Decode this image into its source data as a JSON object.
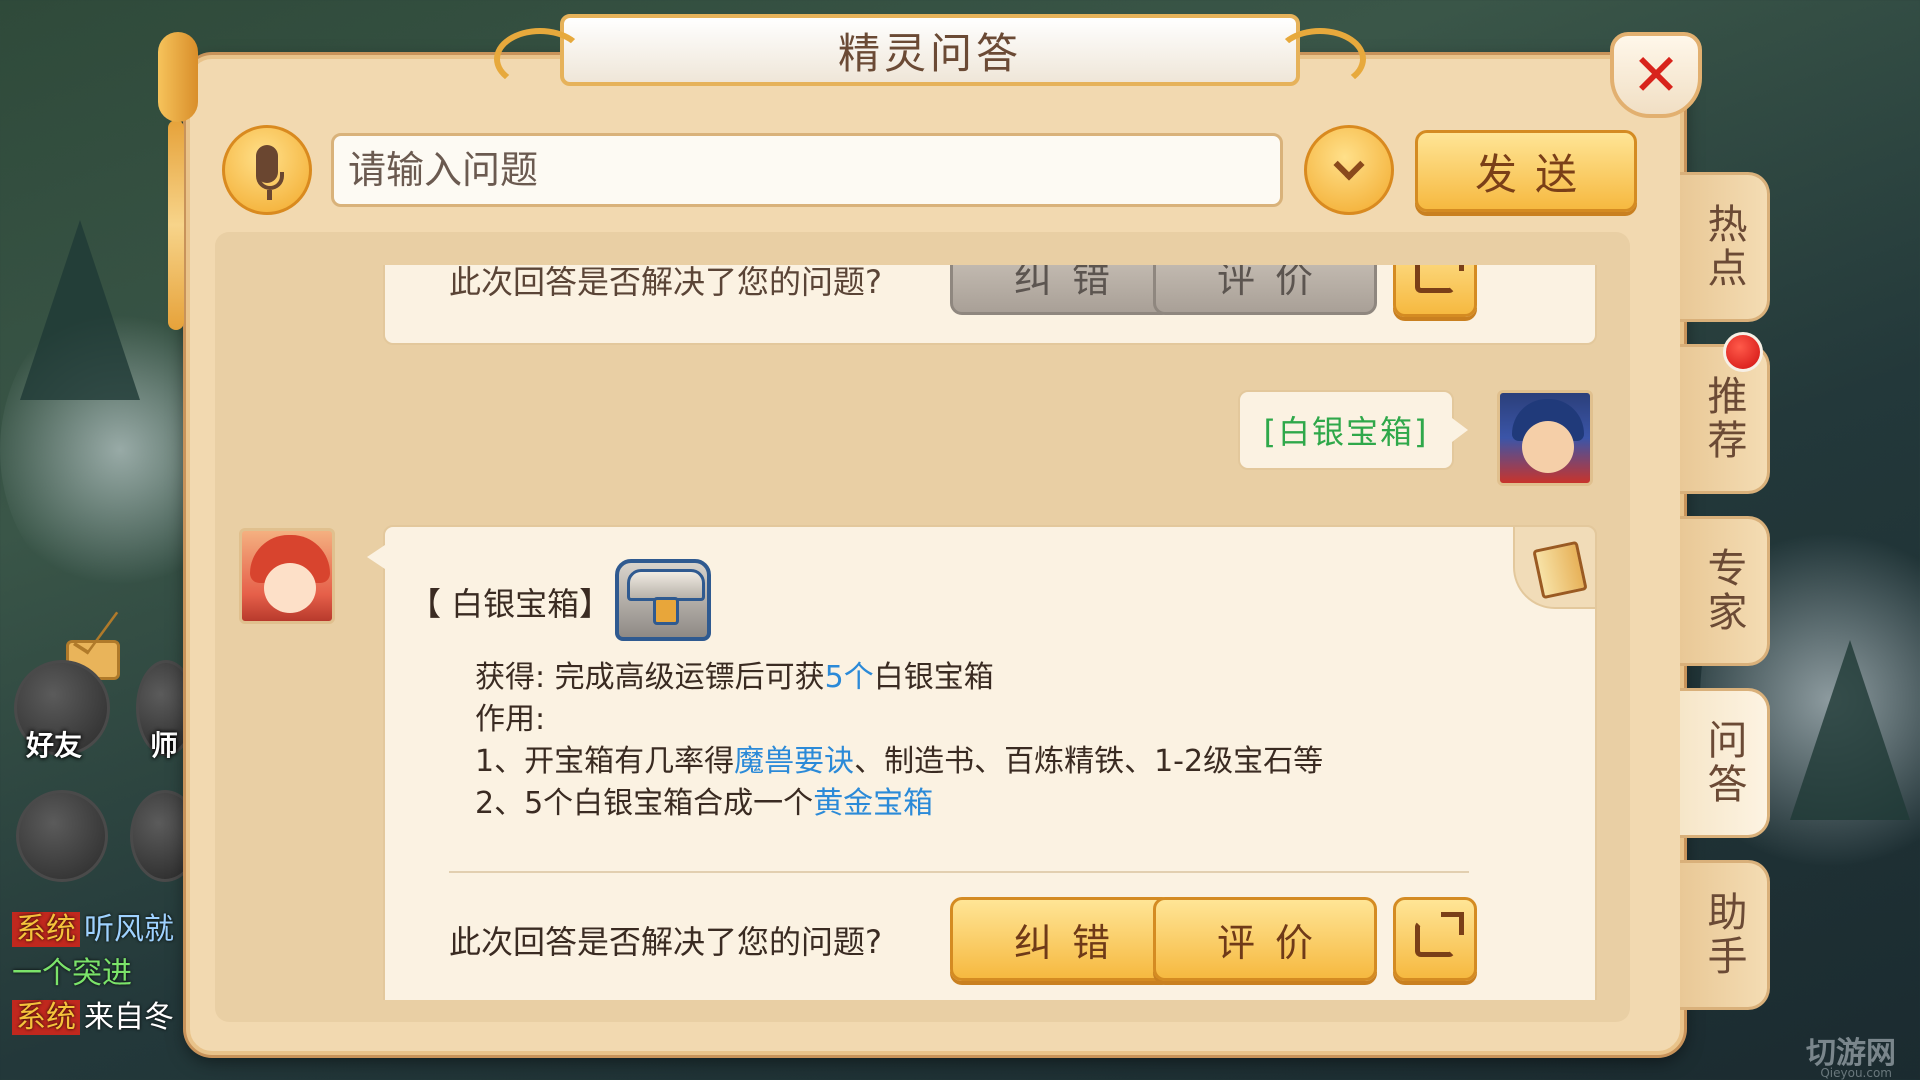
{
  "window": {
    "title": "精灵问答"
  },
  "search": {
    "placeholder": "请输入问题",
    "send_label": "发送"
  },
  "hud": {
    "friends_label": "好友",
    "master_label": "师",
    "chat_lines": [
      {
        "tag": "系统",
        "text": "听风就"
      },
      {
        "tag": "",
        "text": "一个突进"
      },
      {
        "tag": "系统",
        "text": "来自冬"
      }
    ]
  },
  "conversation": {
    "prev_question": "此次回答是否解决了您的问题?",
    "prev_correct_label": "纠错",
    "prev_rate_label": "评价",
    "user_message": "[白银宝箱]",
    "answer": {
      "title": "【 白银宝箱】",
      "obtain_prefix": "获得: 完成高级运镖后可获",
      "obtain_link": "5个",
      "obtain_suffix": "白银宝箱",
      "effect_label": "作用:",
      "line1_prefix": "1、开宝箱有几率得",
      "line1_link": "魔兽要诀",
      "line1_suffix": "、制造书、百炼精铁、1-2级宝石等",
      "line2_prefix": "2、5个白银宝箱合成一个",
      "line2_link": "黄金宝箱"
    },
    "feedback_question": "此次回答是否解决了您的问题?",
    "correct_label": "纠错",
    "rate_label": "评价"
  },
  "tabs": [
    {
      "label": "热点",
      "active": false
    },
    {
      "label": "推荐",
      "active": false
    },
    {
      "label": "专家",
      "active": false
    },
    {
      "label": "问答",
      "active": true
    },
    {
      "label": "助手",
      "active": false
    }
  ],
  "icons": [
    "microphone-icon",
    "chevron-down-icon",
    "close-icon",
    "share-icon",
    "treasure-chest-icon",
    "book-icon",
    "mail-icon"
  ],
  "colors": {
    "link": "#2b8ad8",
    "user_message": "#2fa84a",
    "close": "#d8231c",
    "button_gold": "#f6b940"
  },
  "watermark": {
    "text": "切游网",
    "sub": "Qieyou.com"
  }
}
